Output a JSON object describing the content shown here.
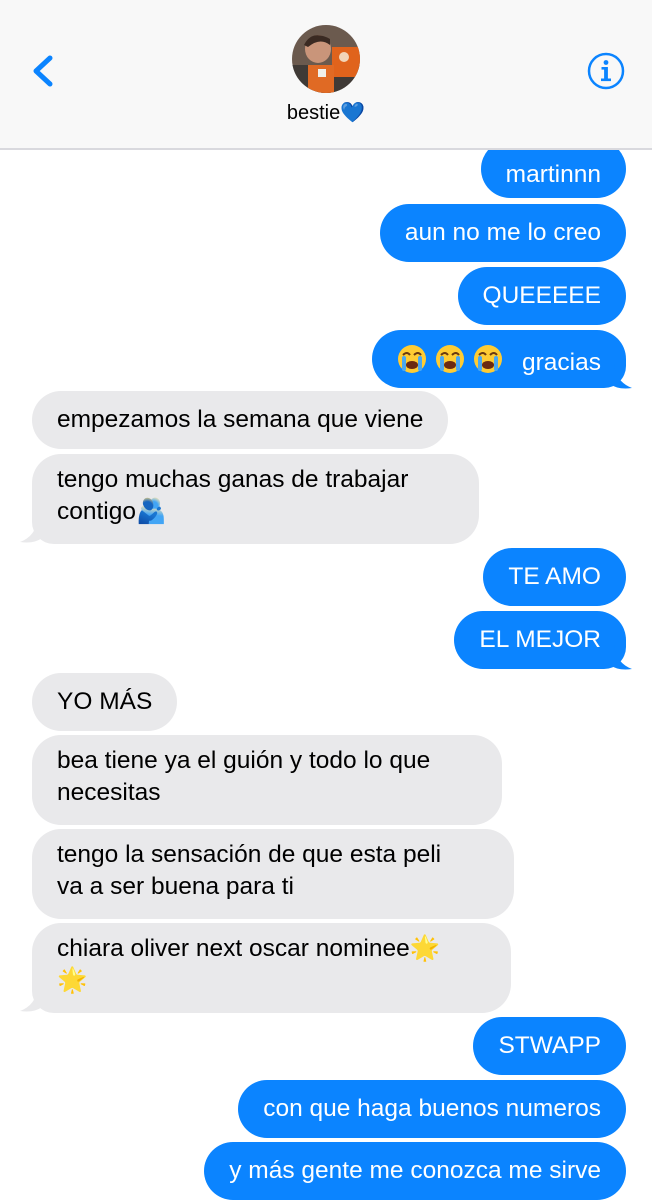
{
  "header": {
    "contact_name": "bestie💙",
    "back_icon": "chevron-left-icon",
    "info_icon": "info-icon",
    "accent_color": "#0b84ff"
  },
  "messages": [
    {
      "from": "me",
      "text": "martinnn"
    },
    {
      "from": "me",
      "text": "aun no me lo creo"
    },
    {
      "from": "me",
      "text": "QUEEEEE"
    },
    {
      "from": "me",
      "text": "gracias",
      "emoji_prefix": "😭😭😭"
    },
    {
      "from": "them",
      "text": "empezamos la semana que viene"
    },
    {
      "from": "them",
      "text": "tengo muchas ganas de trabajar",
      "text2": "contigo🫂"
    },
    {
      "from": "me",
      "text": "TE AMO"
    },
    {
      "from": "me",
      "text": "EL MEJOR"
    },
    {
      "from": "them",
      "text": "YO MÁS"
    },
    {
      "from": "them",
      "text": "bea tiene ya el guión y todo lo que",
      "text2": "necesitas"
    },
    {
      "from": "them",
      "text": "tengo la sensación de que esta peli",
      "text2": "va a ser buena para ti"
    },
    {
      "from": "them",
      "text": "chiara oliver next oscar nominee🌟",
      "text2": "🌟"
    },
    {
      "from": "me",
      "text": "STWAPP"
    },
    {
      "from": "me",
      "text": "con que haga buenos numeros"
    },
    {
      "from": "me",
      "text": "y más gente me conozca me sirve"
    }
  ],
  "colors": {
    "sent_bubble": "#0b84ff",
    "received_bubble": "#e9e9eb",
    "header_bg": "#f8f8f8"
  }
}
